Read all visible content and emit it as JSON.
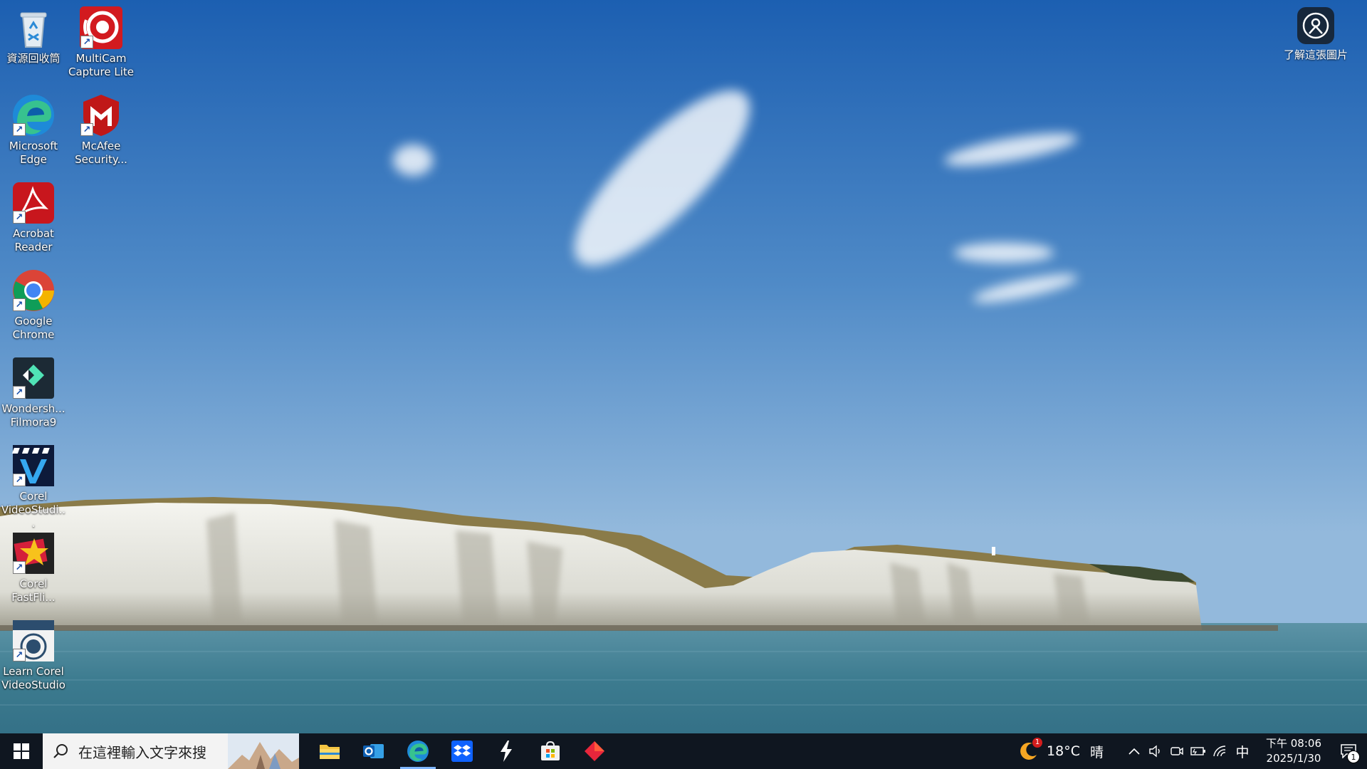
{
  "desktop": {
    "icons": [
      {
        "label": "資源回收筒",
        "icon": "recycle-bin-icon"
      },
      {
        "label": "MultiCam Capture Lite",
        "icon": "multicam-capture-icon"
      },
      {
        "label": "Microsoft Edge",
        "icon": "edge-icon"
      },
      {
        "label": "McAfee Security...",
        "icon": "mcafee-icon"
      },
      {
        "label": "Acrobat Reader",
        "icon": "acrobat-reader-icon"
      },
      {
        "label": "Google Chrome",
        "icon": "chrome-icon"
      },
      {
        "label": "Wondersh... Filmora9",
        "icon": "filmora-icon"
      },
      {
        "label": "Corel VideoStudi...",
        "icon": "corel-videostudio-icon"
      },
      {
        "label": "Corel FastFli...",
        "icon": "corel-fastflick-icon"
      },
      {
        "label": "Learn Corel VideoStudio",
        "icon": "learn-corel-icon"
      }
    ],
    "learn_picture_label": "了解這張圖片"
  },
  "taskbar": {
    "search_placeholder": "在這裡輸入文字來搜",
    "pinned": [
      {
        "name": "file-explorer",
        "icon": "folder-icon"
      },
      {
        "name": "outlook",
        "icon": "outlook-icon"
      },
      {
        "name": "edge",
        "icon": "edge-icon",
        "active": true
      },
      {
        "name": "dropbox",
        "icon": "dropbox-icon"
      },
      {
        "name": "bolt-app",
        "icon": "lightning-icon"
      },
      {
        "name": "microsoft-store",
        "icon": "store-icon"
      },
      {
        "name": "red-diamond-app",
        "icon": "diamond-icon"
      }
    ],
    "weather": {
      "temp": "18°C",
      "condition": "晴",
      "badge": "1"
    },
    "ime": "中",
    "time": "下午 08:06",
    "date": "2025/1/30",
    "notification_count": "1"
  },
  "colors": {
    "taskbar_bg": "#0f1620",
    "sky_top": "#1f63b3",
    "sky_bottom": "#8db4d8",
    "sea": "#3f7e93"
  }
}
